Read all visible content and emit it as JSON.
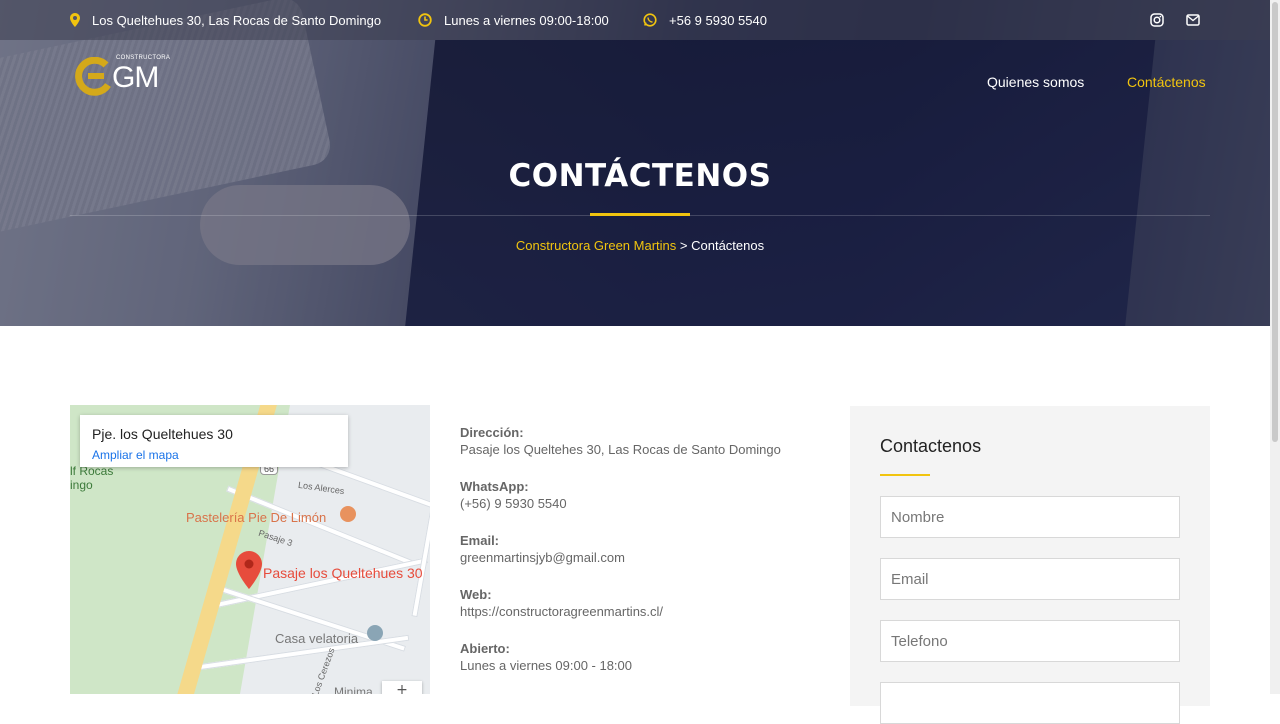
{
  "topbar": {
    "address": "Los Queltehues 30, Las Rocas de Santo Domingo",
    "hours": "Lunes a viernes 09:00-18:00",
    "phone": "+56 9 5930 5540"
  },
  "logo": {
    "brand": "GM",
    "tagline": "CONSTRUCTORA"
  },
  "nav": {
    "items": [
      {
        "label": "Quienes somos",
        "active": false
      },
      {
        "label": "Contáctenos",
        "active": true
      }
    ]
  },
  "hero": {
    "title": "CONTÁCTENOS",
    "breadcrumb_home": "Constructora Green Martins",
    "breadcrumb_sep": " > ",
    "breadcrumb_current": "Contáctenos"
  },
  "map": {
    "place_title": "Pje. los Queltehues 30",
    "enlarge_link": "Ampliar el mapa",
    "labels": {
      "lf_rocas": "lf Rocas",
      "ingo": "ingo",
      "los_alerces": "Los Alerces",
      "pasteleria": "Pastelería Pie De Limón",
      "pasaje3": "Pasaje 3",
      "marker": "Pasaje los Queltehues 30",
      "velatoria": "Casa velatoria",
      "cerezos": "Los Cerezos",
      "minima": "Minima",
      "route": "66"
    },
    "zoom_in": "+"
  },
  "info": [
    {
      "label": "Dirección:",
      "value": "Pasaje los Queltehes 30, Las Rocas de Santo Domingo"
    },
    {
      "label": "WhatsApp:",
      "value": "(+56) 9 5930 5540"
    },
    {
      "label": "Email:",
      "value": "greenmartinsjyb@gmail.com"
    },
    {
      "label": "Web:",
      "value": "https://constructoragreenmartins.cl/"
    },
    {
      "label": "Abierto:",
      "value": "Lunes a viernes 09:00 - 18:00"
    }
  ],
  "form": {
    "title": "Contactenos",
    "name_placeholder": "Nombre",
    "email_placeholder": "Email",
    "phone_placeholder": "Telefono"
  },
  "colors": {
    "accent": "#f1c40f",
    "hero_dark": "#1f2447",
    "map_marker": "#e74c3c",
    "link_blue": "#1a73e8"
  },
  "icons": [
    "map-pin-icon",
    "clock-icon",
    "whatsapp-icon",
    "instagram-icon",
    "envelope-icon"
  ]
}
